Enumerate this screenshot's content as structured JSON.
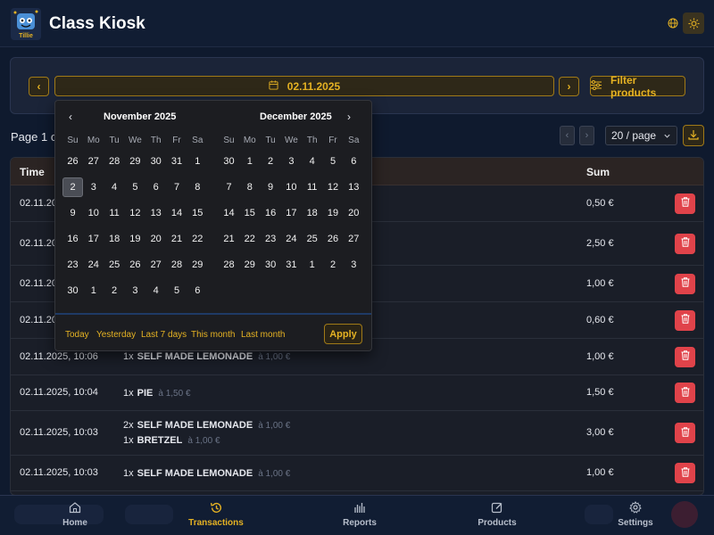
{
  "header": {
    "title": "Class Kiosk",
    "logo_text": "Tillie"
  },
  "filter": {
    "date_value": "02.11.2025",
    "filter_label": "Filter products"
  },
  "pagination": {
    "page_text": "Page 1 of",
    "per_page": "20 / page"
  },
  "table": {
    "headers": {
      "time": "Time",
      "sum": "Sum"
    },
    "rows": [
      {
        "time": "02.11.20",
        "sum": "0,50 €",
        "items": []
      },
      {
        "time": "02.11.20",
        "sum": "2,50 €",
        "items": []
      },
      {
        "time": "02.11.20",
        "sum": "1,00 €",
        "items": []
      },
      {
        "time": "02.11.20",
        "sum": "0,60 €",
        "items": []
      },
      {
        "time": "02.11.2025, 10:06",
        "sum": "1,00 €",
        "items": [
          {
            "qty": "1x",
            "name": "SELF MADE LEMONADE",
            "price": "à 1,00 €"
          }
        ]
      },
      {
        "time": "02.11.2025, 10:04",
        "sum": "1,50 €",
        "items": [
          {
            "qty": "1x",
            "name": "PIE",
            "price": "à 1,50 €"
          }
        ]
      },
      {
        "time": "02.11.2025, 10:03",
        "sum": "3,00 €",
        "items": [
          {
            "qty": "2x",
            "name": "SELF MADE LEMONADE",
            "price": "à 1,00 €"
          },
          {
            "qty": "1x",
            "name": "BRETZEL",
            "price": "à 1,00 €"
          }
        ]
      },
      {
        "time": "02.11.2025, 10:03",
        "sum": "1,00 €",
        "items": [
          {
            "qty": "1x",
            "name": "SELF MADE LEMONADE",
            "price": "à 1,00 €"
          }
        ]
      }
    ]
  },
  "datepicker": {
    "weekdays": [
      "Su",
      "Mo",
      "Tu",
      "We",
      "Th",
      "Fr",
      "Sa"
    ],
    "months": [
      {
        "title": "November 2025",
        "weeks": [
          [
            "26",
            "27",
            "28",
            "29",
            "30",
            "31",
            "1"
          ],
          [
            "2",
            "3",
            "4",
            "5",
            "6",
            "7",
            "8"
          ],
          [
            "9",
            "10",
            "11",
            "12",
            "13",
            "14",
            "15"
          ],
          [
            "16",
            "17",
            "18",
            "19",
            "20",
            "21",
            "22"
          ],
          [
            "23",
            "24",
            "25",
            "26",
            "27",
            "28",
            "29"
          ],
          [
            "30",
            "1",
            "2",
            "3",
            "4",
            "5",
            "6"
          ]
        ],
        "selected": [
          1,
          0
        ]
      },
      {
        "title": "December 2025",
        "weeks": [
          [
            "30",
            "1",
            "2",
            "3",
            "4",
            "5",
            "6"
          ],
          [
            "7",
            "8",
            "9",
            "10",
            "11",
            "12",
            "13"
          ],
          [
            "14",
            "15",
            "16",
            "17",
            "18",
            "19",
            "20"
          ],
          [
            "21",
            "22",
            "23",
            "24",
            "25",
            "26",
            "27"
          ],
          [
            "28",
            "29",
            "30",
            "31",
            "1",
            "2",
            "3"
          ]
        ]
      }
    ],
    "presets": [
      "Today",
      "Yesterday",
      "Last 7 days",
      "This month",
      "Last month"
    ],
    "apply_label": "Apply"
  },
  "nav": {
    "items": [
      {
        "label": "Home",
        "icon": "home-icon"
      },
      {
        "label": "Transactions",
        "icon": "history-icon",
        "active": true
      },
      {
        "label": "Reports",
        "icon": "bar-chart-icon"
      },
      {
        "label": "Products",
        "icon": "edit-icon"
      },
      {
        "label": "Settings",
        "icon": "gear-icon"
      }
    ]
  },
  "colors": {
    "accent": "#e5b223",
    "danger": "#e0434a",
    "background": "#0f1a2e",
    "surface": "#1a1e28"
  }
}
